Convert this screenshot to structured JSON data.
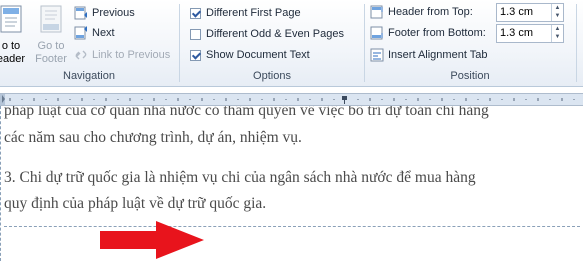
{
  "ribbon": {
    "navigation": {
      "group_label": "Navigation",
      "goto_header": {
        "line1": "o to",
        "line2": "eader"
      },
      "goto_footer": {
        "line1": "Go to",
        "line2": "Footer"
      },
      "previous": "Previous",
      "next": "Next",
      "link_to_previous": "Link to Previous"
    },
    "options": {
      "group_label": "Options",
      "different_first_page": {
        "label": "Different First Page",
        "checked": true
      },
      "different_odd_even": {
        "label": "Different Odd & Even Pages",
        "checked": false
      },
      "show_document_text": {
        "label": "Show Document Text",
        "checked": true
      }
    },
    "position": {
      "group_label": "Position",
      "header_from_top": {
        "label": "Header from Top:",
        "value": "1.3 cm"
      },
      "footer_from_bottom": {
        "label": "Footer from Bottom:",
        "value": "1.3 cm"
      },
      "insert_alignment_tab": "Insert Alignment Tab"
    }
  },
  "document": {
    "line0": "pháp luật của cơ quan nhà nước có thẩm quyền về việc bố trí dự toán chi hàng",
    "line1": "các năm sau cho chương trình, dự án, nhiệm vụ.",
    "line2": "3. Chi dự trữ quốc gia là nhiệm vụ chi của ngân sách nhà nước để mua hàng",
    "line3": "quy định của pháp luật về dự trữ quốc gia."
  },
  "colors": {
    "arrow": "#e8141c",
    "ruler": "#dbe5f1",
    "ribbon_accent": "#2f5aa0"
  }
}
